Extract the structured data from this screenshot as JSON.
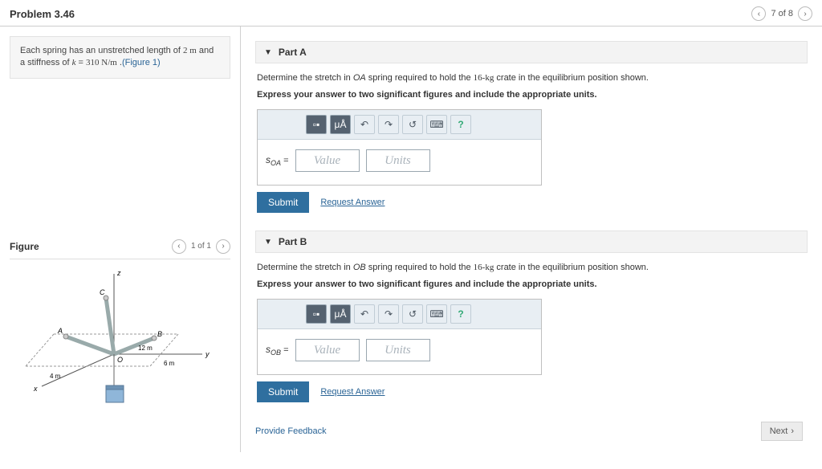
{
  "header": {
    "title": "Problem 3.46",
    "pager_text": "7 of 8"
  },
  "intro": {
    "text_a": "Each spring has an unstretched length of ",
    "len": "2 m",
    "text_b": " and a stiffness of ",
    "kvar": "k",
    "eq": " = ",
    "kval": "310 N/m",
    "text_c": " .",
    "figlink": "(Figure 1)"
  },
  "figure": {
    "title": "Figure",
    "pager": "1 of 1",
    "labels": {
      "z": "z",
      "x": "x",
      "y": "y",
      "C": "C",
      "A": "A",
      "B": "B",
      "O": "O",
      "d12": "12 m",
      "d6": "6 m",
      "d4": "4 m"
    }
  },
  "partA": {
    "label": "Part A",
    "prompt_a": "Determine the stretch in ",
    "spring": "OA",
    "prompt_b": " spring required to hold the ",
    "mass": "16-kg",
    "prompt_c": " crate in the equilibrium position shown.",
    "instruct": "Express your answer to two significant figures and include the appropriate units.",
    "var_html": "s",
    "var_sub": "OA",
    "value_ph": "Value",
    "units_ph": "Units",
    "submit": "Submit",
    "request": "Request Answer"
  },
  "partB": {
    "label": "Part B",
    "prompt_a": "Determine the stretch in ",
    "spring": "OB",
    "prompt_b": " spring required to hold the ",
    "mass": "16-kg",
    "prompt_c": " crate in the equilibrium position shown.",
    "instruct": "Express your answer to two significant figures and include the appropriate units.",
    "var_html": "s",
    "var_sub": "OB",
    "value_ph": "Value",
    "units_ph": "Units",
    "submit": "Submit",
    "request": "Request Answer"
  },
  "toolbar": {
    "templates": "▫▪",
    "mu": "μÅ",
    "undo": "↶",
    "redo": "↷",
    "reset": "↺",
    "keyboard": "⌨",
    "help": "?"
  },
  "footer": {
    "feedback": "Provide Feedback",
    "next": "Next"
  }
}
